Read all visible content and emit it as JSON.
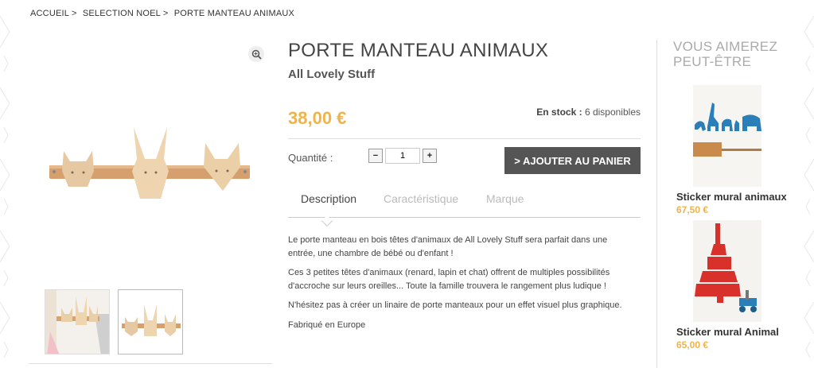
{
  "breadcrumb": {
    "items": [
      "ACCUEIL",
      ">",
      "SELECTION NOEL",
      ">",
      "PORTE MANTEAU ANIMAUX"
    ]
  },
  "product": {
    "title": "PORTE MANTEAU ANIMAUX",
    "brand": "All Lovely Stuff",
    "price": "38,00 €",
    "stock_label": "En stock :",
    "stock_value": "6 disponibles",
    "quantity_label": "Quantité :",
    "quantity_value": "1",
    "minus": "−",
    "plus": "+",
    "add_to_cart": "> AJOUTER AU PANIER",
    "zoom_icon": "zoom-in-icon"
  },
  "tabs": [
    {
      "label": "Description",
      "active": true
    },
    {
      "label": "Caractéristique",
      "active": false
    },
    {
      "label": "Marque",
      "active": false
    }
  ],
  "description": [
    "Le porte manteau en bois têtes d'animaux de All Lovely Stuff sera parfait dans une entrée, une chambre de bébé ou d'enfant !",
    "Ces 3 petites têtes d'animaux (renard, lapin et chat) offrent de multiples possibilités d'accroche sur leurs oreilles... Toute la famille trouvera le rangement plus ludique !",
    "N'hésitez pas à créer un linaire de porte manteaux pour un effet visuel plus graphique.",
    "Fabriqué en Europe"
  ],
  "related": {
    "title_line1": "VOUS AIMEREZ",
    "title_line2": "PEUT-ÊTRE",
    "items": [
      {
        "name": "Sticker mural animaux",
        "price": "67,50 €"
      },
      {
        "name": "Sticker mural Animal",
        "price": "65,00 €"
      }
    ]
  },
  "colors": {
    "price": "#f0b34a",
    "button": "#555555",
    "sticker_blue": "#2a7fb8",
    "sticker_red": "#d8302a"
  }
}
